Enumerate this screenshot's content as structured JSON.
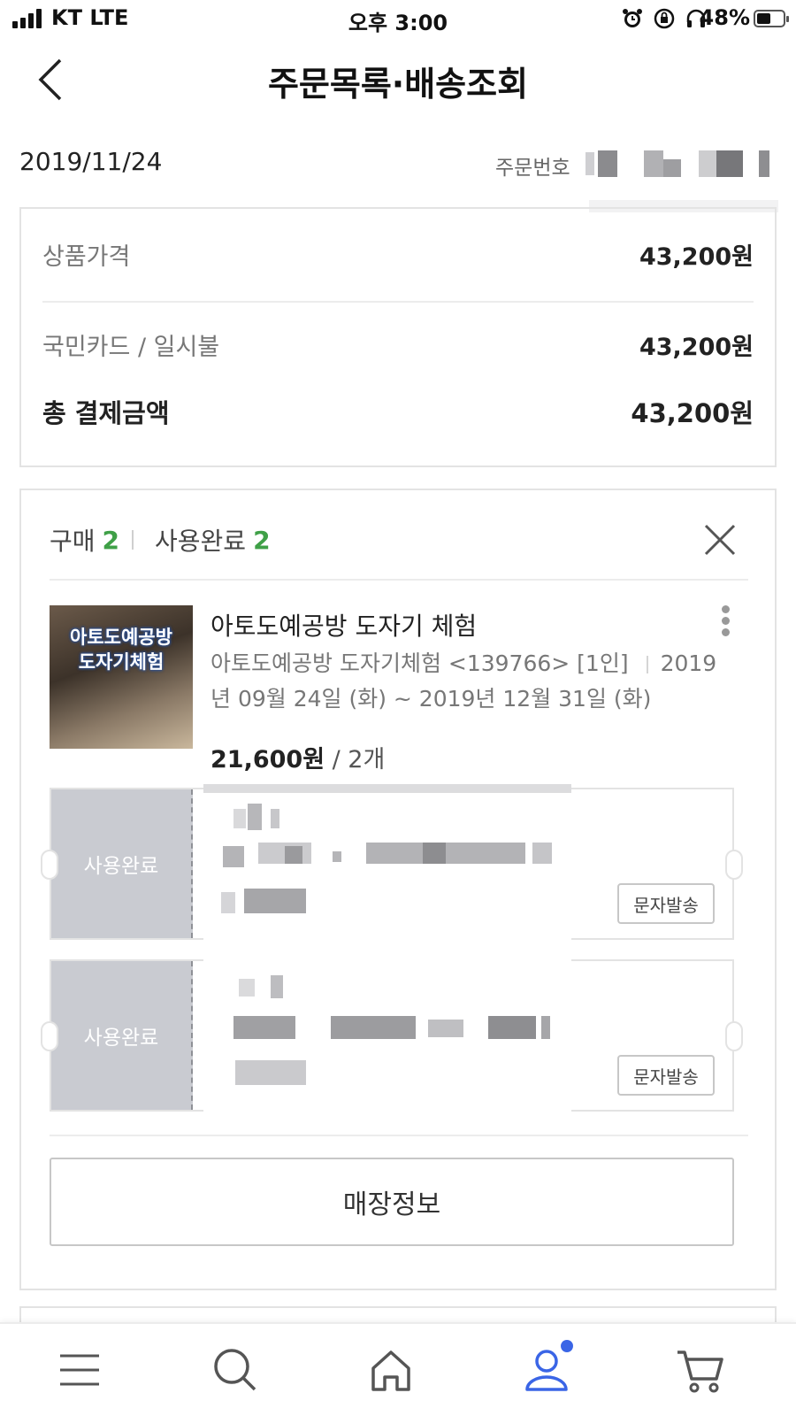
{
  "status_bar": {
    "carrier": "KT LTE",
    "time": "오후 3:00",
    "battery": "48%"
  },
  "header": {
    "title": "주문목록·배송조회"
  },
  "order": {
    "date": "2019/11/24",
    "number_label": "주문번호"
  },
  "payment": {
    "rows": [
      {
        "label": "상품가격",
        "value": "43,200원"
      },
      {
        "label": "국민카드 / 일시불",
        "value": "43,200원"
      }
    ],
    "total_label": "총 결제금액",
    "total_value": "43,200원"
  },
  "purchase": {
    "bought_label": "구매",
    "bought_count": "2",
    "used_label": "사용완료",
    "used_count": "2"
  },
  "product": {
    "thumb_line1": "아토도예공방",
    "thumb_line2": "도자기체험",
    "name": "아토도예공방 도자기 체험",
    "option_main": "아토도예공방 도자기체험 <139766> [1인]",
    "option_period_start": "2019",
    "option_period_rest": "년 09월 24일 (화) ~ 2019년 12월 31일 (화)",
    "price": "21,600원",
    "quantity": " / 2개"
  },
  "tickets": [
    {
      "status": "사용완료",
      "action": "문자발송"
    },
    {
      "status": "사용완료",
      "action": "문자발송"
    }
  ],
  "store_button": "매장정보",
  "colors": {
    "accent_green": "#3fa047",
    "nav_active": "#3a65e6",
    "ticket_stub": "#c9cbd1"
  },
  "bottom_nav": {
    "items": [
      "menu-icon",
      "search-icon",
      "home-icon",
      "my-page-icon",
      "cart-icon"
    ],
    "active": "my-page-icon"
  }
}
